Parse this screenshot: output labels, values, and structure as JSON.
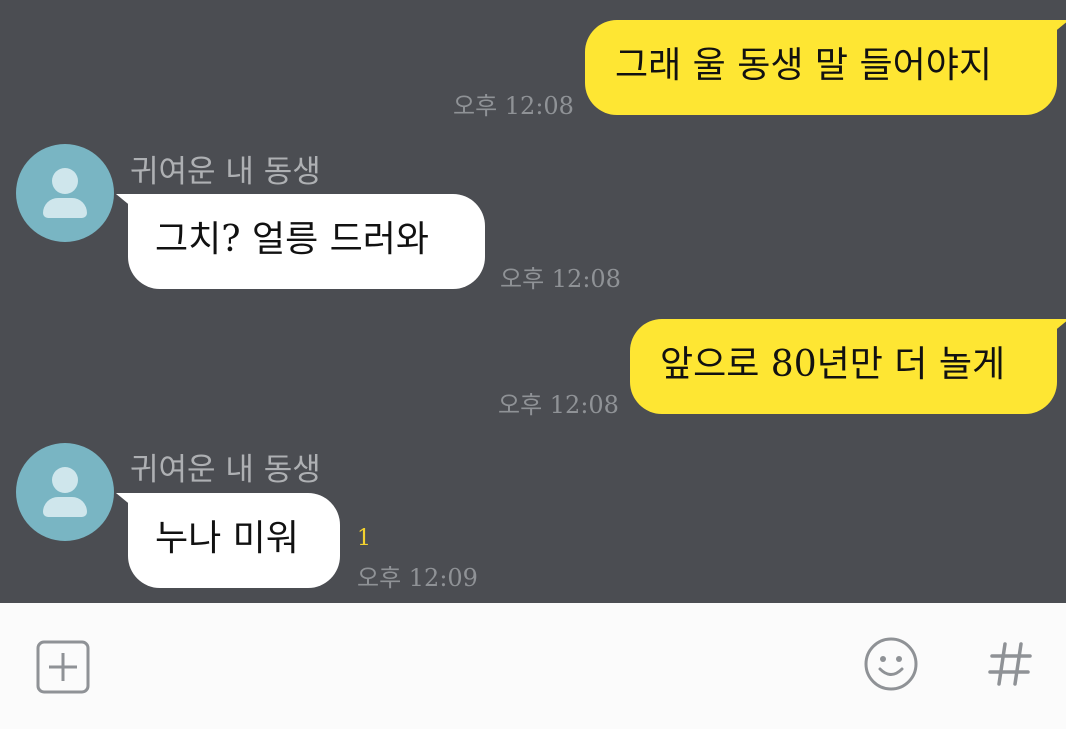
{
  "messages": [
    {
      "type": "out",
      "text": "그래 울 동생 말 들어야지",
      "time": "오후 12:08"
    },
    {
      "type": "in",
      "sender": "귀여운 내 동생",
      "text": "그치? 얼릉 드러와",
      "time": "오후 12:08"
    },
    {
      "type": "out",
      "text": "앞으로 80년만 더 놀게",
      "time": "오후 12:08"
    },
    {
      "type": "in",
      "sender": "귀여운 내 동생",
      "text": "누나 미워",
      "time": "오후 12:09",
      "unread": "1"
    }
  ],
  "input_bar": {
    "icons": [
      "plus-icon",
      "emoji-icon",
      "hashtag-icon"
    ]
  },
  "colors": {
    "chat_background": "#4b4d52",
    "outgoing_bubble": "#fee633",
    "incoming_bubble": "#ffffff",
    "avatar": "#79b5c3",
    "unread_count": "#f3d22f"
  }
}
